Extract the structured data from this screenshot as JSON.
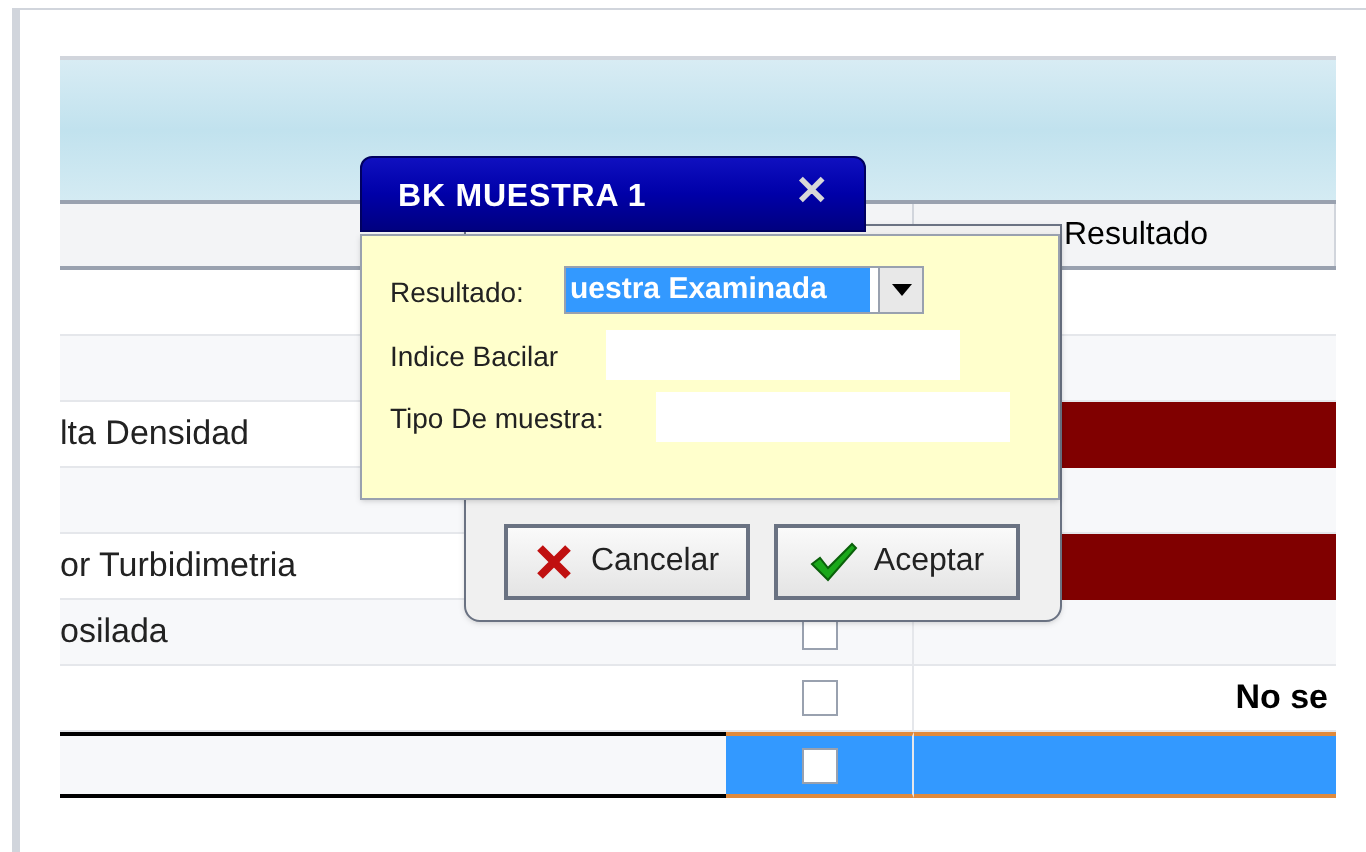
{
  "table": {
    "columns": [
      {},
      {},
      {
        "label": "Resultado"
      }
    ],
    "rows": [
      {
        "flagged": false,
        "selected": false
      },
      {
        "flagged": false,
        "selected": false
      },
      {
        "cell_1": "lta Densidad",
        "flagged": true,
        "selected": false
      },
      {
        "flagged": false,
        "selected": false
      },
      {
        "cell_1": "or Turbidimetria",
        "flagged": true,
        "selected": false
      },
      {
        "cell_1": "osilada",
        "checked": false,
        "flagged": false,
        "selected": false
      },
      {
        "checked": false,
        "cell_3": "No se",
        "flagged": false,
        "selected": false
      },
      {
        "checked": false,
        "flagged": false,
        "selected": true
      }
    ]
  },
  "dialog": {
    "title": "BK MUESTRA 1",
    "close": "✕",
    "fields": [
      {
        "kind": "combo",
        "label": "Resultado:",
        "value": "uestra Examinada"
      },
      {
        "kind": "text",
        "label": "Indice Bacilar"
      },
      {
        "kind": "text",
        "label": "Tipo De muestra:"
      }
    ],
    "buttons": [
      {
        "kind": "cancel",
        "label": "Cancelar"
      },
      {
        "kind": "ok",
        "label": "Aceptar"
      }
    ]
  }
}
